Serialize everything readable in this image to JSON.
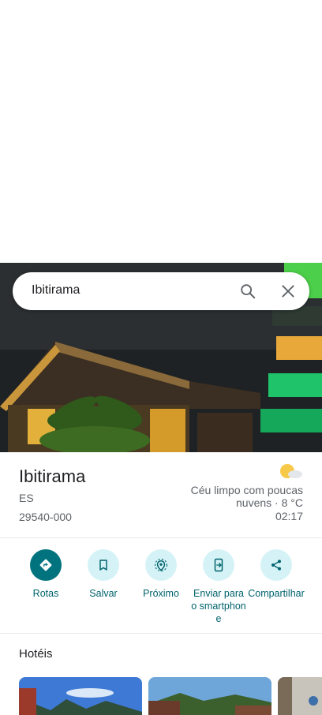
{
  "search": {
    "query": "Ibitirama"
  },
  "place": {
    "name": "Ibitirama",
    "state": "ES",
    "postal_code": "29540-000"
  },
  "weather": {
    "description": "Céu limpo com poucas nuvens · 8 °C",
    "time": "02:17",
    "icon": "partly-cloudy-icon"
  },
  "actions": [
    {
      "label": "Rotas",
      "icon": "directions-icon"
    },
    {
      "label": "Salvar",
      "icon": "bookmark-icon"
    },
    {
      "label": "Próximo",
      "icon": "nearby-icon"
    },
    {
      "label": "Enviar para o smartphone",
      "icon": "send-to-phone-icon"
    },
    {
      "label": "Compartilhar",
      "icon": "share-icon"
    }
  ],
  "hotels": {
    "title": "Hotéis"
  },
  "colors": {
    "accent": "#00737f",
    "accent_light": "#d5f3f7",
    "accent_text": "#00636d"
  }
}
